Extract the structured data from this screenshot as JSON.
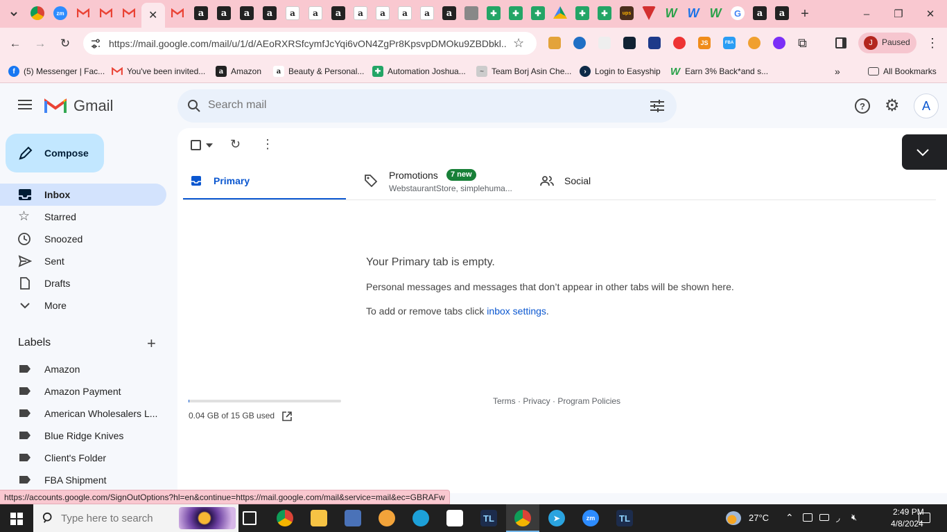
{
  "browser": {
    "url": "https://mail.google.com/mail/u/1/d/AEoRXRSfcymfJcYqi6vON4ZgPr8KpsvpDMOku9ZBDbkl...",
    "profile_label": "Paused",
    "profile_initial": "J",
    "tab_letters": {
      "amazon": "a",
      "google": "G",
      "js": "JS",
      "fba": "FBA",
      "ups": "ups",
      "zoom": "zm"
    },
    "bookmarks": [
      {
        "label": "(5) Messenger | Fac...",
        "icon": "facebook-icon"
      },
      {
        "label": "You've been invited...",
        "icon": "gmail-icon"
      },
      {
        "label": "Amazon",
        "icon": "amazon-icon"
      },
      {
        "label": "Beauty & Personal...",
        "icon": "amazon-icon"
      },
      {
        "label": "Automation Joshua...",
        "icon": "sheets-icon"
      },
      {
        "label": "Team Borj Asin Che...",
        "icon": "team-icon"
      },
      {
        "label": "Login to Easyship",
        "icon": "easyship-icon"
      },
      {
        "label": "Earn 3% Back*and s...",
        "icon": "w-icon"
      }
    ],
    "all_bookmarks_label": "All Bookmarks",
    "status_url": "https://accounts.google.com/SignOutOptions?hl=en&continue=https://mail.google.com/mail&service=mail&ec=GBRAFw"
  },
  "gmail": {
    "logo_text": "Gmail",
    "search_placeholder": "Search mail",
    "account_initial": "A",
    "compose_label": "Compose",
    "nav": [
      {
        "label": "Inbox",
        "icon": "inbox-icon",
        "active": true
      },
      {
        "label": "Starred",
        "icon": "star-icon"
      },
      {
        "label": "Snoozed",
        "icon": "clock-icon"
      },
      {
        "label": "Sent",
        "icon": "send-icon"
      },
      {
        "label": "Drafts",
        "icon": "draft-icon"
      },
      {
        "label": "More",
        "icon": "chevron-down-icon"
      }
    ],
    "labels_title": "Labels",
    "labels": [
      "Amazon",
      "Amazon Payment",
      "American Wholesalers L...",
      "Blue Ridge Knives",
      "Client's Folder",
      "FBA Shipment"
    ],
    "tabs": {
      "primary": "Primary",
      "promotions": "Promotions",
      "promotions_badge": "7 new",
      "promotions_senders": "WebstaurantStore, simplehuma...",
      "social": "Social"
    },
    "empty_title": "Your Primary tab is empty.",
    "empty_body": "Personal messages and messages that don’t appear in other tabs will be shown here.",
    "empty_settings_prefix": "To add or remove tabs click ",
    "empty_settings_link": "inbox settings",
    "empty_settings_suffix": ".",
    "storage_label": "0.04 GB of 15 GB used",
    "storage_fraction": 0.003,
    "footer": "Terms · Privacy · Program Policies"
  },
  "taskbar": {
    "search_placeholder": "Type here to search",
    "weather": "27°C",
    "time": "2:49 PM",
    "date": "4/8/2024"
  },
  "colors": {
    "chrome_frame": "#f9c8d0",
    "gmail_blue": "#0b57d0",
    "compose_bg": "#c2e7ff",
    "inbox_active_bg": "#d3e3fd",
    "promo_badge": "#188038"
  }
}
